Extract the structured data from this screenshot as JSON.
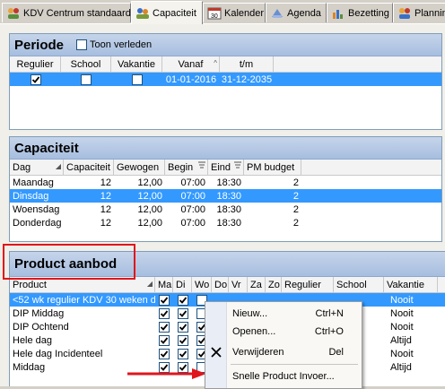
{
  "tabs": [
    {
      "label": "KDV Centrum standaard",
      "icon": "group-icon"
    },
    {
      "label": "Capaciteit",
      "icon": "users-icon"
    },
    {
      "label": "Kalender",
      "icon": "calendar-icon"
    },
    {
      "label": "Agenda",
      "icon": "agenda-icon"
    },
    {
      "label": "Bezetting",
      "icon": "chart-icon"
    },
    {
      "label": "Plannin",
      "icon": "planning-icon"
    }
  ],
  "periode": {
    "title": "Periode",
    "toon_verleden": "Toon verleden",
    "columns": [
      "Regulier",
      "School",
      "Vakantie",
      "Vanaf",
      "t/m"
    ],
    "rows": [
      {
        "regulier": true,
        "school": false,
        "vakantie": false,
        "vanaf": "01-01-2016",
        "tm": "31-12-2035"
      }
    ]
  },
  "capaciteit": {
    "title": "Capaciteit",
    "columns": [
      "Dag",
      "Capaciteit",
      "Gewogen",
      "Begin",
      "Eind",
      "PM budget"
    ],
    "rows": [
      {
        "dag": "Maandag",
        "capaciteit": "12",
        "gewogen": "12,00",
        "begin": "07:00",
        "eind": "18:30",
        "pm": "2"
      },
      {
        "dag": "Dinsdag",
        "capaciteit": "12",
        "gewogen": "12,00",
        "begin": "07:00",
        "eind": "18:30",
        "pm": "2"
      },
      {
        "dag": "Woensdag",
        "capaciteit": "12",
        "gewogen": "12,00",
        "begin": "07:00",
        "eind": "18:30",
        "pm": "2"
      },
      {
        "dag": "Donderdag",
        "capaciteit": "12",
        "gewogen": "12,00",
        "begin": "07:00",
        "eind": "18:30",
        "pm": "2"
      }
    ]
  },
  "product": {
    "title": "Product aanbod",
    "columns": [
      "Product",
      "Ma",
      "Di",
      "Wo",
      "Do",
      "Vr",
      "Za",
      "Zo",
      "Regulier",
      "School",
      "Vakantie"
    ],
    "rows": [
      {
        "product": "<52 wk regulier KDV 30 weken d",
        "vakantie": "Nooit"
      },
      {
        "product": "DIP Middag",
        "vakantie": "Nooit"
      },
      {
        "product": "DIP Ochtend",
        "vakantie": "Nooit"
      },
      {
        "product": "Hele dag",
        "vakantie": "Altijd"
      },
      {
        "product": "Hele dag Incidenteel",
        "vakantie": "Nooit"
      },
      {
        "product": "Middag",
        "vakantie": "Altijd"
      }
    ]
  },
  "context_menu": {
    "items": [
      {
        "label": "Nieuw...",
        "key": "N",
        "shortcut": "Ctrl+N"
      },
      {
        "label": "Openen...",
        "key": "O",
        "shortcut": "Ctrl+O"
      },
      {
        "label": "Verwijderen",
        "key": "V",
        "shortcut": "Del"
      },
      {
        "label": "Snelle Product Invoer...",
        "key": "",
        "shortcut": ""
      }
    ]
  },
  "colors": {
    "selection": "#3399ff",
    "panel_header": "#b6c9e6",
    "highlight_box": "#e0161c"
  }
}
